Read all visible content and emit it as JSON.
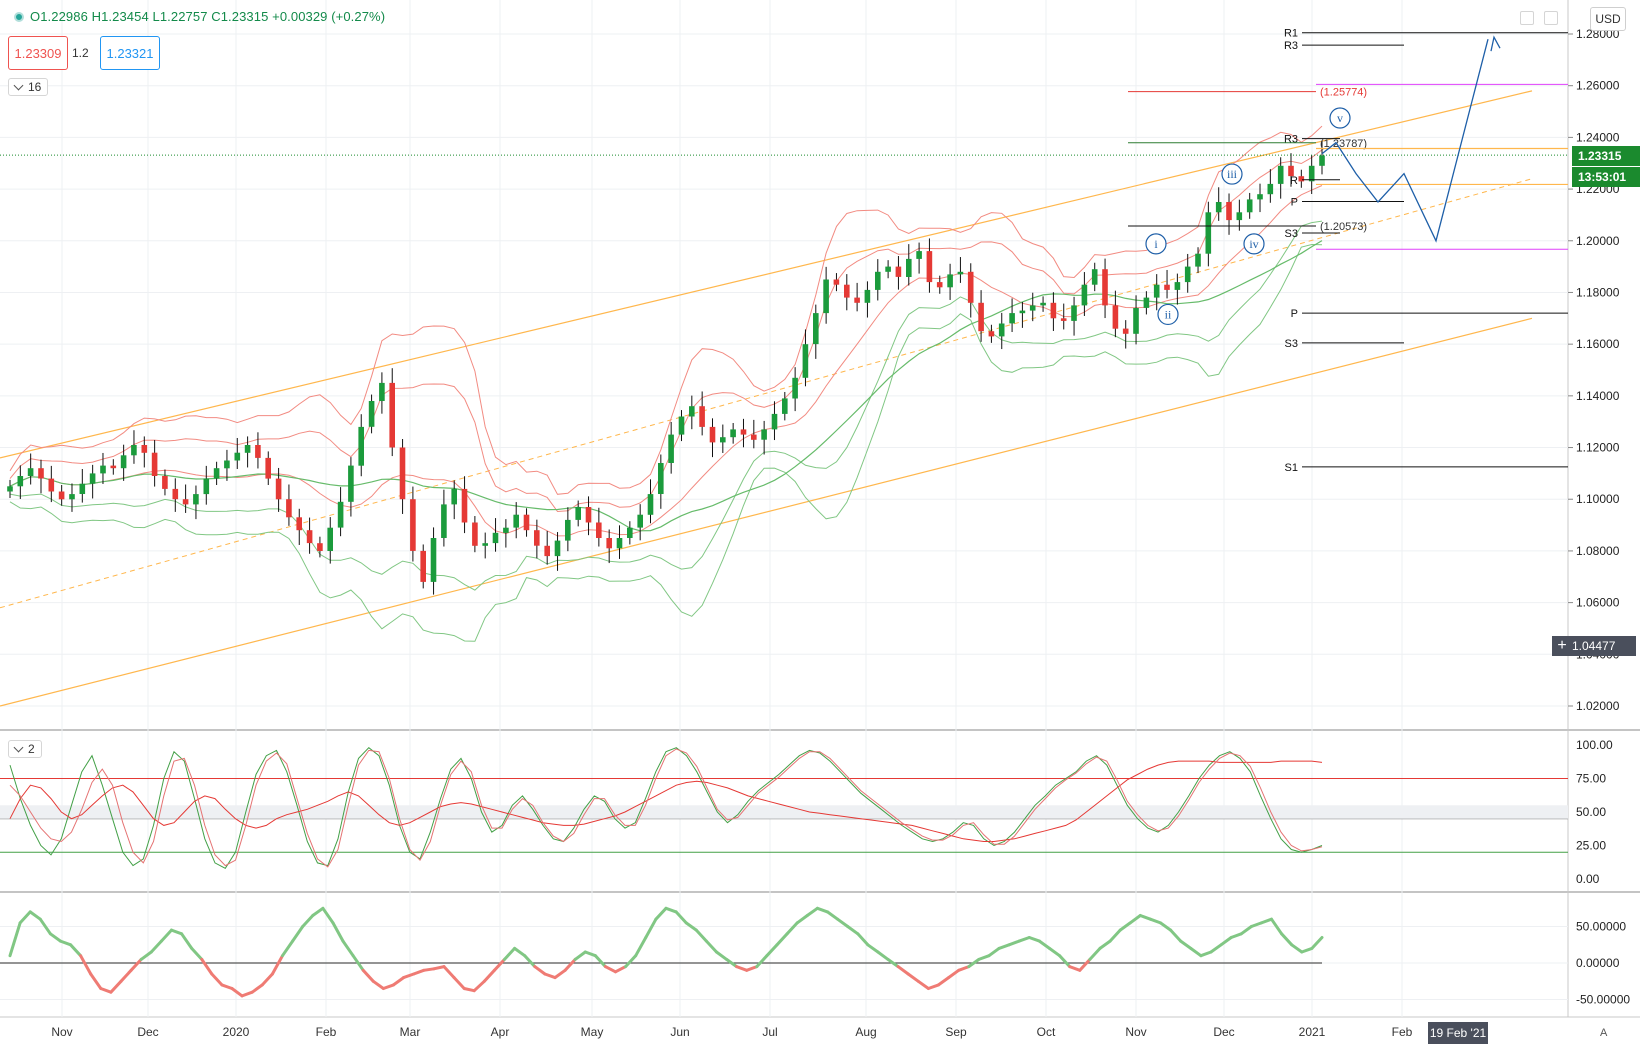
{
  "header": {
    "ohlc_text": "O1.22986 H1.23454 L1.22757 C1.23315 +0.00329 (+0.27%)",
    "sell_price": "1.23309",
    "spread": "1.2",
    "buy_price": "1.23321",
    "legend_main": "16",
    "legend_osc": "2",
    "currency": "USD"
  },
  "colors": {
    "up": "#26a69a",
    "up_candle": "#1b9b3c",
    "down_candle": "#e53935",
    "bb_red": "#f28b82",
    "bb_green": "#81c784",
    "channel": "#ffb74d",
    "wave": "#1e5fa8",
    "pivot": "#111111",
    "magenta": "#e040fb"
  },
  "price_tags": {
    "last_price": "1.23315",
    "countdown": "13:53:01",
    "crosshair_price": "1.04477",
    "crosshair_date": "19 Feb '21"
  },
  "pivots": [
    {
      "label": "R1",
      "price": 1.2805
    },
    {
      "label": "R3",
      "price": 1.2757
    },
    {
      "label": "R3",
      "price": 1.2395
    },
    {
      "label": "R",
      "price": 1.2236
    },
    {
      "label": "P",
      "price": 1.2152
    },
    {
      "label": "S3",
      "price": 1.203
    },
    {
      "label": "P",
      "price": 1.172
    },
    {
      "label": "S3",
      "price": 1.1605
    },
    {
      "label": "S1",
      "price": 1.1125
    }
  ],
  "fib_labels": [
    {
      "text": "(1.25774)",
      "price": 1.2577
    },
    {
      "text": "(1.23787)",
      "price": 1.2379
    },
    {
      "text": "(1.20573)",
      "price": 1.2057
    }
  ],
  "wave_labels": [
    "i",
    "ii",
    "iii",
    "iv",
    "v"
  ],
  "auto_label": "A",
  "chart_data": [
    {
      "type": "candlestick",
      "title": "",
      "ylabel": "USD",
      "ylim": [
        1.01,
        1.285
      ],
      "yticks": [
        "1.28000",
        "1.26000",
        "1.24000",
        "1.22000",
        "1.20000",
        "1.18000",
        "1.16000",
        "1.14000",
        "1.12000",
        "1.10000",
        "1.08000",
        "1.06000",
        "1.04000",
        "1.02000"
      ],
      "xticks": [
        "Nov",
        "Dec",
        "2020",
        "Feb",
        "Mar",
        "Apr",
        "May",
        "Jun",
        "Jul",
        "Aug",
        "Sep",
        "Oct",
        "Nov",
        "Dec",
        "2021",
        "Feb"
      ],
      "closes": [
        1.105,
        1.109,
        1.112,
        1.108,
        1.103,
        1.1,
        1.102,
        1.106,
        1.11,
        1.113,
        1.112,
        1.117,
        1.121,
        1.118,
        1.109,
        1.104,
        1.1,
        1.098,
        1.102,
        1.108,
        1.112,
        1.115,
        1.118,
        1.121,
        1.116,
        1.108,
        1.1,
        1.093,
        1.088,
        1.083,
        1.08,
        1.089,
        1.099,
        1.113,
        1.128,
        1.138,
        1.145,
        1.12,
        1.1,
        1.08,
        1.068,
        1.085,
        1.098,
        1.104,
        1.091,
        1.082,
        1.083,
        1.087,
        1.089,
        1.094,
        1.088,
        1.082,
        1.078,
        1.084,
        1.092,
        1.097,
        1.091,
        1.085,
        1.081,
        1.085,
        1.089,
        1.094,
        1.102,
        1.114,
        1.125,
        1.132,
        1.136,
        1.128,
        1.122,
        1.124,
        1.127,
        1.125,
        1.123,
        1.127,
        1.133,
        1.139,
        1.147,
        1.16,
        1.172,
        1.185,
        1.183,
        1.178,
        1.176,
        1.181,
        1.188,
        1.19,
        1.186,
        1.193,
        1.196,
        1.184,
        1.182,
        1.187,
        1.188,
        1.176,
        1.165,
        1.163,
        1.168,
        1.172,
        1.173,
        1.175,
        1.176,
        1.17,
        1.169,
        1.175,
        1.183,
        1.189,
        1.175,
        1.166,
        1.164,
        1.174,
        1.178,
        1.183,
        1.181,
        1.184,
        1.19,
        1.195,
        1.211,
        1.215,
        1.208,
        1.211,
        1.216,
        1.218,
        1.222,
        1.229,
        1.225,
        1.223,
        1.229,
        1.233
      ],
      "channel": {
        "upper": [
          [
            1.116,
            1.258
          ]
        ],
        "lower": [
          [
            1.02,
            1.17
          ]
        ]
      },
      "projection": [
        1.2337,
        1.238,
        1.226,
        1.215,
        1.226,
        1.2,
        1.278
      ]
    },
    {
      "type": "line",
      "title": "",
      "ylim": [
        0,
        100
      ],
      "yticks": [
        "100.00",
        "75.00",
        "50.00",
        "25.00",
        "0.00"
      ],
      "levels": [
        75,
        45,
        20
      ],
      "series": [
        {
          "values": [
            85,
            60,
            40,
            25,
            18,
            30,
            55,
            80,
            92,
            70,
            45,
            20,
            10,
            15,
            40,
            75,
            95,
            88,
            60,
            30,
            12,
            8,
            20,
            50,
            78,
            92,
            96,
            80,
            55,
            28,
            12,
            10,
            30,
            65,
            90,
            98,
            92,
            70,
            40,
            20,
            15,
            35,
            60,
            82,
            90,
            75,
            50,
            35,
            40,
            55,
            62,
            52,
            40,
            30,
            28,
            38,
            52,
            62,
            58,
            45,
            38,
            42,
            60,
            80,
            95,
            98,
            92,
            80,
            65,
            50,
            42,
            48,
            58,
            66,
            72,
            78,
            85,
            92,
            96,
            94,
            88,
            80,
            72,
            64,
            58,
            52,
            46,
            40,
            35,
            30,
            28,
            30,
            35,
            42,
            40,
            30,
            25,
            28,
            35,
            45,
            55,
            62,
            70,
            75,
            80,
            88,
            92,
            85,
            70,
            55,
            45,
            38,
            35,
            40,
            50,
            62,
            75,
            85,
            92,
            95,
            90,
            80,
            62,
            45,
            30,
            22,
            20,
            22,
            25
          ]
        },
        {
          "values": [
            45,
            60,
            70,
            68,
            60,
            50,
            45,
            48,
            55,
            62,
            68,
            70,
            65,
            55,
            45,
            40,
            42,
            50,
            58,
            62,
            60,
            52,
            45,
            40,
            38,
            40,
            45,
            48,
            50,
            52,
            55,
            58,
            62,
            65,
            62,
            55,
            48,
            42,
            40,
            42,
            46,
            50,
            54,
            56,
            57,
            56,
            54,
            52,
            50,
            48,
            46,
            44,
            42,
            41,
            40,
            40,
            41,
            43,
            45,
            47,
            50,
            54,
            58,
            62,
            66,
            70,
            72,
            73,
            72,
            70,
            68,
            65,
            62,
            60,
            58,
            56,
            54,
            52,
            50,
            49,
            48,
            47,
            46,
            45,
            44,
            43,
            42,
            41,
            40,
            38,
            36,
            34,
            32,
            30,
            29,
            28,
            28,
            29,
            30,
            32,
            34,
            36,
            38,
            40,
            44,
            50,
            56,
            62,
            68,
            74,
            78,
            82,
            85,
            87,
            88,
            88,
            88,
            88,
            87,
            87,
            87,
            87,
            87,
            87,
            88,
            88,
            88,
            88,
            87
          ]
        },
        {
          "values": [
            70,
            62,
            50,
            38,
            30,
            28,
            35,
            52,
            72,
            82,
            70,
            42,
            20,
            12,
            28,
            62,
            88,
            90,
            70,
            40,
            18,
            10,
            14,
            40,
            70,
            88,
            94,
            86,
            60,
            34,
            15,
            9,
            22,
            55,
            85,
            96,
            95,
            75,
            45,
            22,
            14,
            28,
            55,
            78,
            88,
            80,
            55,
            38,
            38,
            52,
            60,
            55,
            42,
            32,
            28,
            34,
            48,
            60,
            60,
            48,
            40,
            40,
            55,
            75,
            92,
            97,
            94,
            84,
            68,
            52,
            44,
            46,
            55,
            64,
            70,
            76,
            83,
            90,
            95,
            95,
            90,
            82,
            74,
            66,
            60,
            54,
            48,
            42,
            37,
            32,
            29,
            29,
            33,
            40,
            42,
            33,
            26,
            26,
            32,
            42,
            52,
            60,
            68,
            74,
            79,
            86,
            91,
            88,
            74,
            58,
            48,
            40,
            36,
            38,
            47,
            59,
            72,
            82,
            90,
            94,
            92,
            84,
            68,
            50,
            35,
            25,
            21,
            22,
            24
          ]
        }
      ]
    },
    {
      "type": "area",
      "title": "",
      "ylim": [
        -60,
        85
      ],
      "yticks": [
        "50.00000",
        "0.00000",
        "-50.00000"
      ],
      "values": [
        10,
        55,
        70,
        60,
        40,
        30,
        25,
        10,
        -15,
        -35,
        -40,
        -25,
        -10,
        5,
        15,
        30,
        45,
        40,
        20,
        5,
        -15,
        -30,
        -35,
        -45,
        -40,
        -30,
        -15,
        10,
        30,
        50,
        65,
        75,
        55,
        30,
        10,
        -10,
        -25,
        -35,
        -30,
        -20,
        -15,
        -10,
        -8,
        -5,
        -20,
        -35,
        -38,
        -25,
        -10,
        5,
        20,
        10,
        -5,
        -15,
        -20,
        -10,
        5,
        15,
        10,
        -5,
        -12,
        -5,
        10,
        35,
        60,
        75,
        70,
        55,
        45,
        30,
        15,
        5,
        -5,
        -10,
        -5,
        10,
        25,
        40,
        55,
        65,
        75,
        70,
        60,
        50,
        40,
        25,
        15,
        5,
        -5,
        -15,
        -25,
        -35,
        -30,
        -20,
        -10,
        -5,
        5,
        10,
        20,
        25,
        30,
        35,
        30,
        20,
        10,
        -5,
        -10,
        5,
        20,
        30,
        45,
        55,
        65,
        60,
        55,
        45,
        30,
        20,
        10,
        15,
        25,
        35,
        40,
        50,
        55,
        60,
        40,
        25,
        15,
        20,
        35
      ]
    }
  ]
}
